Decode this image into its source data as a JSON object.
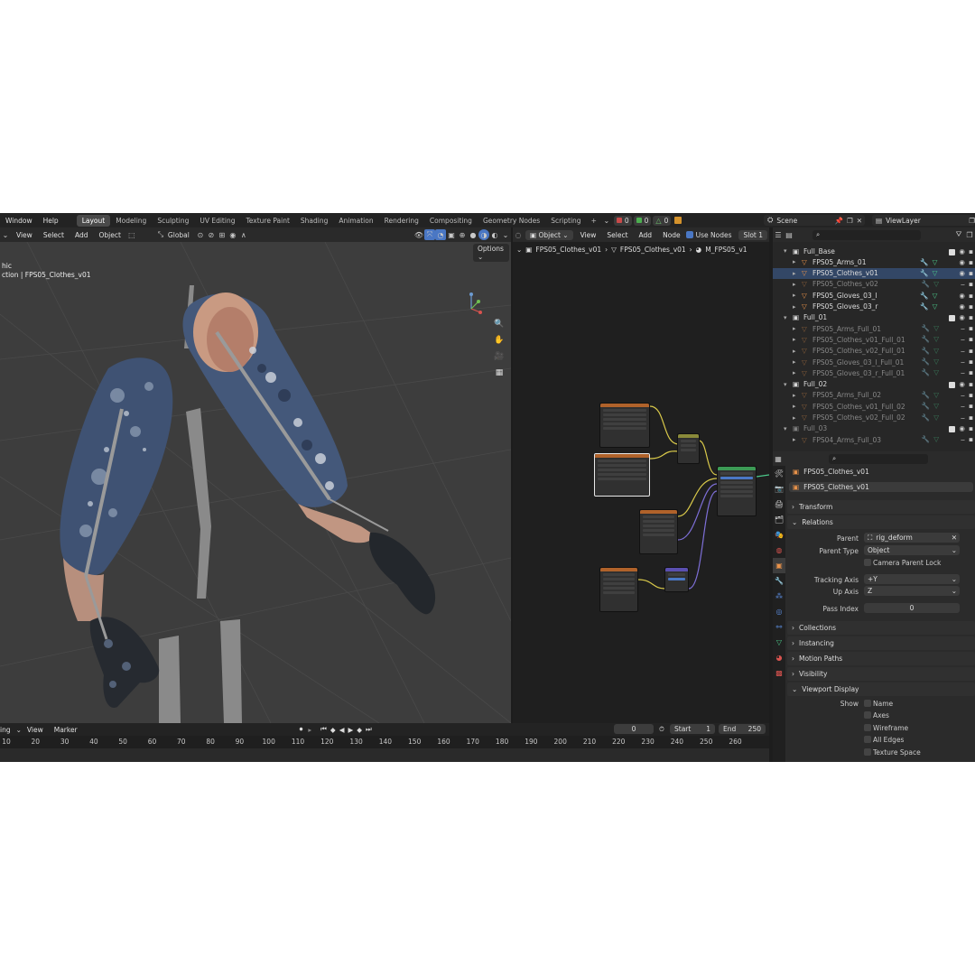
{
  "topbar": {
    "menus": [
      "Window",
      "Help"
    ],
    "workspaces": [
      "Layout",
      "Modeling",
      "Sculpting",
      "UV Editing",
      "Texture Paint",
      "Shading",
      "Animation",
      "Rendering",
      "Compositing",
      "Geometry Nodes",
      "Scripting"
    ],
    "active_workspace": "Layout",
    "plus": "+",
    "stats": [
      "0",
      "0",
      "0"
    ],
    "scene": "Scene",
    "view_layer": "ViewLayer"
  },
  "viewport": {
    "menus": [
      "View",
      "Select",
      "Add",
      "Object"
    ],
    "orientation": "Global",
    "options": "Options",
    "overlay_line1": "hic",
    "overlay_line2": "ction | FPS05_Clothes_v01"
  },
  "node_editor": {
    "mode": "Object",
    "menus": [
      "View",
      "Select",
      "Add",
      "Node"
    ],
    "use_nodes": "Use Nodes",
    "slot": "Slot 1",
    "breadcrumb": [
      "FPS05_Clothes_v01",
      "FPS05_Clothes_v01",
      "M_FPS05_v1"
    ]
  },
  "outliner": {
    "items": [
      {
        "label": "Full_Base",
        "type": "collection",
        "indent": 0,
        "dim": false
      },
      {
        "label": "FPS05_Arms_01",
        "type": "mesh",
        "indent": 1,
        "dim": false
      },
      {
        "label": "FPS05_Clothes_v01",
        "type": "mesh",
        "indent": 1,
        "dim": false
      },
      {
        "label": "FPS05_Clothes_v02",
        "type": "mesh",
        "indent": 1,
        "dim": true
      },
      {
        "label": "FPS05_Gloves_03_l",
        "type": "mesh",
        "indent": 1,
        "dim": false
      },
      {
        "label": "FPS05_Gloves_03_r",
        "type": "mesh",
        "indent": 1,
        "dim": false
      },
      {
        "label": "Full_01",
        "type": "collection",
        "indent": 0,
        "dim": false
      },
      {
        "label": "FPS05_Arms_Full_01",
        "type": "mesh",
        "indent": 1,
        "dim": true
      },
      {
        "label": "FPS05_Clothes_v01_Full_01",
        "type": "mesh",
        "indent": 1,
        "dim": true
      },
      {
        "label": "FPS05_Clothes_v02_Full_01",
        "type": "mesh",
        "indent": 1,
        "dim": true
      },
      {
        "label": "FPS05_Gloves_03_l_Full_01",
        "type": "mesh",
        "indent": 1,
        "dim": true
      },
      {
        "label": "FPS05_Gloves_03_r_Full_01",
        "type": "mesh",
        "indent": 1,
        "dim": true
      },
      {
        "label": "Full_02",
        "type": "collection",
        "indent": 0,
        "dim": false
      },
      {
        "label": "FPS05_Arms_Full_02",
        "type": "mesh",
        "indent": 1,
        "dim": true
      },
      {
        "label": "FPS05_Clothes_v01_Full_02",
        "type": "mesh",
        "indent": 1,
        "dim": true
      },
      {
        "label": "FPS05_Clothes_v02_Full_02",
        "type": "mesh",
        "indent": 1,
        "dim": true
      },
      {
        "label": "Full_03",
        "type": "collection",
        "indent": 0,
        "dim": true
      },
      {
        "label": "FPS04_Arms_Full_03",
        "type": "mesh",
        "indent": 1,
        "dim": true
      }
    ]
  },
  "properties": {
    "object_name": "FPS05_Clothes_v01",
    "data_name": "FPS05_Clothes_v01",
    "sections": {
      "transform": "Transform",
      "relations": "Relations",
      "collections": "Collections",
      "instancing": "Instancing",
      "motion_paths": "Motion Paths",
      "visibility": "Visibility",
      "viewport_display": "Viewport Display"
    },
    "relations": {
      "parent_label": "Parent",
      "parent_value": "rig_deform",
      "parent_type_label": "Parent Type",
      "parent_type_value": "Object",
      "camera_parent_lock": "Camera Parent Lock",
      "tracking_axis_label": "Tracking Axis",
      "tracking_axis_value": "+Y",
      "up_axis_label": "Up Axis",
      "up_axis_value": "Z",
      "pass_index_label": "Pass Index",
      "pass_index_value": "0"
    },
    "viewport_display": {
      "show_label": "Show",
      "options": [
        "Name",
        "Axes",
        "Wireframe",
        "All Edges",
        "Texture Space"
      ]
    }
  },
  "timeline": {
    "menus": [
      "ing",
      "View",
      "Marker"
    ],
    "current_frame": "0",
    "start_label": "Start",
    "start_value": "1",
    "end_label": "End",
    "end_value": "250",
    "ticks": [
      "10",
      "20",
      "30",
      "40",
      "50",
      "60",
      "70",
      "80",
      "90",
      "100",
      "110",
      "120",
      "130",
      "140",
      "150",
      "160",
      "170",
      "180",
      "190",
      "200",
      "210",
      "220",
      "230",
      "240",
      "250",
      "260"
    ]
  },
  "colors": {
    "accent": "#4a77c4",
    "mesh_icon": "#e8924a",
    "collection_icon": "#d8d8d8",
    "modifier_icon": "#5b8de0",
    "material_icon": "#4bc88a"
  }
}
